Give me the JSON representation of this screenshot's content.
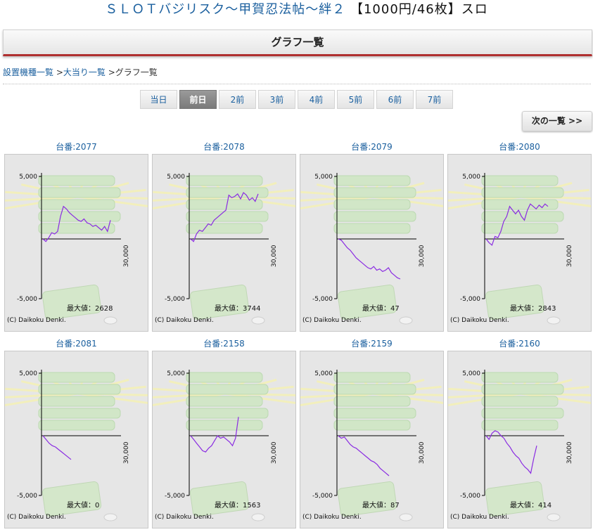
{
  "header": {
    "title": "ＳＬＯＴバジリスク～甲賀忍法帖～絆２",
    "title_suffix": "【1000円/46枚】スロ",
    "section_title": "グラフ一覧"
  },
  "breadcrumb": {
    "item1": "設置機種一覧",
    "sep1": " >",
    "item2": "大当り一覧",
    "sep2": " >",
    "current": "グラフ一覧"
  },
  "tabs": [
    "当日",
    "前日",
    "2前",
    "3前",
    "4前",
    "5前",
    "6前",
    "7前"
  ],
  "active_tab": "前日",
  "next_button": "次の一覧 >>",
  "graph_common": {
    "y_top_label": "5,000",
    "y_bottom_label": "-5,000",
    "x_label": "30,000",
    "max_prefix": "最大値：",
    "copyright": "(C) Daikoku Denki.",
    "line_color": "#8a2be2",
    "y_range": [
      -5000,
      5000
    ]
  },
  "machines": [
    {
      "label": "台番:2077",
      "max": "2628",
      "series": [
        0,
        -200,
        100,
        500,
        400,
        600,
        1800,
        2600,
        2400,
        2100,
        1900,
        1700,
        1500,
        1400,
        1600,
        1300,
        1200,
        1000,
        1100,
        900,
        700,
        1000,
        600,
        1500
      ]
    },
    {
      "label": "台番:2078",
      "max": "3744",
      "series": [
        0,
        -200,
        400,
        700,
        600,
        900,
        1200,
        1100,
        1500,
        1700,
        1900,
        2100,
        2300,
        3500,
        3300,
        3400,
        3600,
        3200,
        3700,
        3500,
        3100,
        3300,
        3000,
        3600
      ]
    },
    {
      "label": "台番:2079",
      "max": "47",
      "series": [
        0,
        -100,
        -400,
        -700,
        -900,
        -1200,
        -1500,
        -1700,
        -1900,
        -2100,
        -2300,
        -2400,
        -2200,
        -2500,
        -2400,
        -2600,
        -2500,
        -2300,
        -2700,
        -2900,
        -3100,
        -3200
      ]
    },
    {
      "label": "台番:2080",
      "max": "2843",
      "series": [
        0,
        -300,
        -500,
        200,
        100,
        600,
        1400,
        1800,
        2600,
        2300,
        2000,
        2300,
        1800,
        1500,
        2300,
        2800,
        2600,
        2400,
        2700,
        2500,
        2800,
        2600
      ]
    },
    {
      "label": "台番:2081",
      "max": "0",
      "series": [
        0,
        -300,
        -600,
        -800,
        -900,
        -1100,
        -1300,
        -1500,
        -1700,
        -1900
      ]
    },
    {
      "label": "台番:2158",
      "max": "1563",
      "series": [
        0,
        -300,
        -600,
        -900,
        -1200,
        -1300,
        -1000,
        -800,
        -400,
        0,
        -200,
        -100,
        -300,
        -500,
        -800,
        -200,
        1500
      ]
    },
    {
      "label": "台番:2159",
      "max": "87",
      "series": [
        0,
        -200,
        -100,
        -400,
        -700,
        -900,
        -1000,
        -1200,
        -1400,
        -1600,
        -1800,
        -2000,
        -2100,
        -2300,
        -2600,
        -2800,
        -3000,
        -3200
      ]
    },
    {
      "label": "台番:2160",
      "max": "414",
      "series": [
        0,
        -300,
        200,
        400,
        300,
        0,
        -200,
        -600,
        -900,
        -1300,
        -1600,
        -1800,
        -2200,
        -2500,
        -2700,
        -3000,
        -1800,
        -800
      ]
    }
  ]
}
